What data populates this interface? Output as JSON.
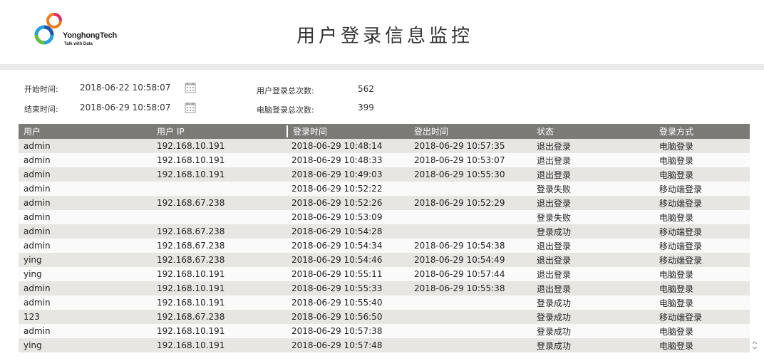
{
  "header": {
    "title": "用户登录信息监控",
    "logo": {
      "name": "YonghongTech",
      "tagline": "Talk with Data"
    }
  },
  "filters": {
    "start_label": "开始时间:",
    "start_value": "2018-06-22 10:58:07",
    "end_label": "结束时间:",
    "end_value": "2018-06-29 10:58:07",
    "total_login_label": "用户登录总次数:",
    "total_login_value": "562",
    "pc_login_label": "电脑登录总次数:",
    "pc_login_value": "399"
  },
  "table": {
    "columns": [
      "用户",
      "用户 IP",
      "登录时间",
      "登出时间",
      "状态",
      "登录方式"
    ],
    "rows": [
      [
        "admin",
        "192.168.10.191",
        "2018-06-29 10:48:14",
        "2018-06-29 10:57:35",
        "退出登录",
        "电脑登录"
      ],
      [
        "admin",
        "192.168.10.191",
        "2018-06-29 10:48:33",
        "2018-06-29 10:53:07",
        "退出登录",
        "电脑登录"
      ],
      [
        "admin",
        "192.168.10.191",
        "2018-06-29 10:49:03",
        "2018-06-29 10:55:30",
        "退出登录",
        "电脑登录"
      ],
      [
        "admin",
        "",
        "2018-06-29 10:52:22",
        "",
        "登录失败",
        "移动端登录"
      ],
      [
        "admin",
        "192.168.67.238",
        "2018-06-29 10:52:26",
        "2018-06-29 10:52:29",
        "退出登录",
        "移动端登录"
      ],
      [
        "admin",
        "",
        "2018-06-29 10:53:09",
        "",
        "登录失败",
        "电脑登录"
      ],
      [
        "admin",
        "192.168.67.238",
        "2018-06-29 10:54:28",
        "",
        "登录成功",
        "移动端登录"
      ],
      [
        "admin",
        "192.168.67.238",
        "2018-06-29 10:54:34",
        "2018-06-29 10:54:38",
        "退出登录",
        "移动端登录"
      ],
      [
        "ying",
        "192.168.67.238",
        "2018-06-29 10:54:46",
        "2018-06-29 10:54:49",
        "退出登录",
        "移动端登录"
      ],
      [
        "ying",
        "192.168.10.191",
        "2018-06-29 10:55:11",
        "2018-06-29 10:57:44",
        "退出登录",
        "电脑登录"
      ],
      [
        "admin",
        "192.168.10.191",
        "2018-06-29 10:55:33",
        "2018-06-29 10:55:38",
        "退出登录",
        "电脑登录"
      ],
      [
        "admin",
        "192.168.10.191",
        "2018-06-29 10:55:40",
        "",
        "登录成功",
        "电脑登录"
      ],
      [
        "123",
        "192.168.67.238",
        "2018-06-29 10:56:50",
        "",
        "登录成功",
        "移动端登录"
      ],
      [
        "admin",
        "192.168.10.191",
        "2018-06-29 10:57:38",
        "",
        "登录成功",
        "电脑登录"
      ],
      [
        "ying",
        "192.168.10.191",
        "2018-06-29 10:57:48",
        "",
        "登录成功",
        "电脑登录"
      ]
    ]
  },
  "colors": {
    "header_bg": "#7b7a77",
    "row_odd": "#e7e6e2",
    "row_even": "#fafafa",
    "divider": "#e9e9e9"
  },
  "icons": [
    "calendar-icon",
    "scroll-arrows-icon"
  ]
}
